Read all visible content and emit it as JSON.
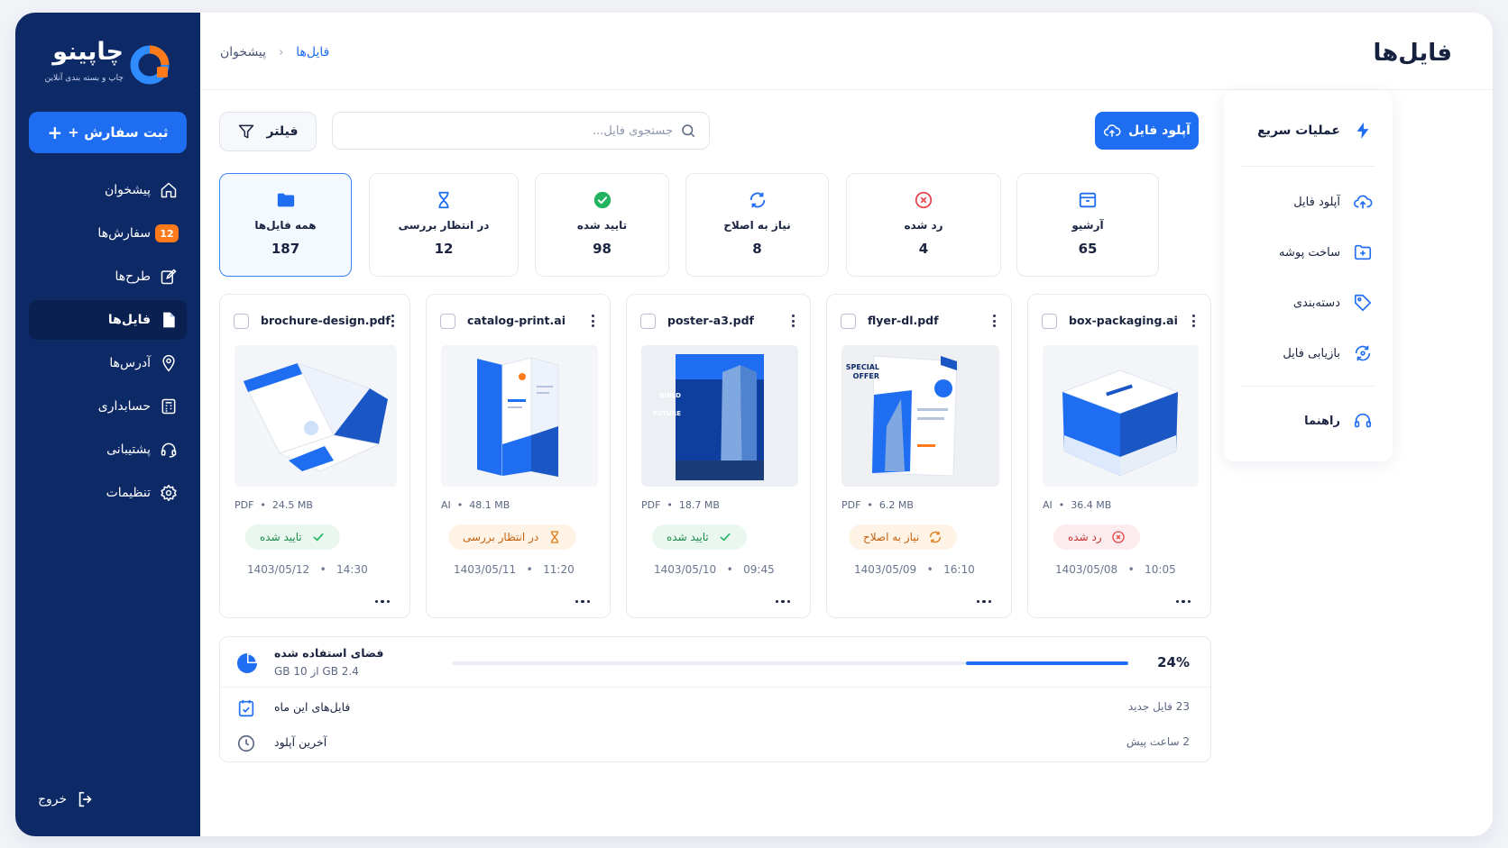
{
  "brand": {
    "name": "چاپینو",
    "tagline": "چاپ و بسته بندی آنلاین"
  },
  "sidebar": {
    "new_order_label": "ثبت سفارش +",
    "items": [
      {
        "label": "پیشخوان",
        "icon": "home-icon"
      },
      {
        "label": "سفارش‌ها",
        "icon": "orders-icon",
        "badge": "12"
      },
      {
        "label": "طرح‌ها",
        "icon": "design-icon"
      },
      {
        "label": "فایل‌ها",
        "icon": "file-icon",
        "active": true
      },
      {
        "label": "آدرس‌ها",
        "icon": "location-icon"
      },
      {
        "label": "حسابداری",
        "icon": "accounting-icon"
      },
      {
        "label": "پشتیبانی",
        "icon": "headset-icon"
      },
      {
        "label": "تنظیمات",
        "icon": "gear-icon"
      }
    ],
    "logout_label": "خروج"
  },
  "header": {
    "title": "فایل‌ها",
    "breadcrumb": [
      "پیشخوان",
      "فایل‌ها"
    ]
  },
  "toolbar": {
    "upload_label": "آپلود فایل",
    "search_placeholder": "جستجوی فایل...",
    "filter_label": "فیلتر"
  },
  "stats": [
    {
      "label": "همه فایل‌ها",
      "count": "187",
      "icon": "folder-icon",
      "color": "#1f6ef2"
    },
    {
      "label": "در انتظار بررسی",
      "count": "12",
      "icon": "hourglass-icon",
      "color": "#1f6ef2"
    },
    {
      "label": "تایید شده",
      "count": "98",
      "icon": "check-circle-icon",
      "color": "#22b35e"
    },
    {
      "label": "نیاز به اصلاح",
      "count": "8",
      "icon": "refresh-icon",
      "color": "#1f6ef2"
    },
    {
      "label": "رد شده",
      "count": "4",
      "icon": "x-circle-icon",
      "color": "#e5484d"
    },
    {
      "label": "آرشیو",
      "count": "65",
      "icon": "archive-icon",
      "color": "#1f6ef2"
    }
  ],
  "files": [
    {
      "name": "brochure-design.pdf",
      "type": "PDF",
      "size": "24.5 MB",
      "status": "تایید شده",
      "status_key": "approved",
      "date": "1403/05/12",
      "time": "14:30"
    },
    {
      "name": "catalog-print.ai",
      "type": "AI",
      "size": "48.1 MB",
      "status": "در انتظار بررسی",
      "status_key": "pending",
      "date": "1403/05/11",
      "time": "11:20"
    },
    {
      "name": "poster-a3.pdf",
      "type": "PDF",
      "size": "18.7 MB",
      "status": "تایید شده",
      "status_key": "approved",
      "date": "1403/05/10",
      "time": "09:45",
      "thumb_text": [
        "BUILD",
        "FUTURE"
      ]
    },
    {
      "name": "flyer-dl.pdf",
      "type": "PDF",
      "size": "6.2 MB",
      "status": "نیاز به اصلاح",
      "status_key": "needs-fix",
      "date": "1403/05/09",
      "time": "16:10",
      "thumb_text": [
        "SPECIAL",
        "OFFER"
      ]
    },
    {
      "name": "box-packaging.ai",
      "type": "AI",
      "size": "36.4 MB",
      "status": "رد شده",
      "status_key": "rejected",
      "date": "1403/05/08",
      "time": "10:05"
    }
  ],
  "storage": {
    "title": "فضای استفاده شده",
    "used_text": "2.4 GB از 10 GB",
    "percent_label": "24%",
    "percent": 24,
    "rows": [
      {
        "label": "فایل‌های این ماه",
        "value": "23 فایل جدید",
        "icon": "calendar-file-icon"
      },
      {
        "label": "آخرین آپلود",
        "value": "2 ساعت پیش",
        "icon": "clock-icon"
      }
    ]
  },
  "quick_actions": {
    "title": "عملیات سریع",
    "items": [
      {
        "label": "آپلود فایل",
        "icon": "cloud-upload-icon"
      },
      {
        "label": "ساخت پوشه",
        "icon": "folder-plus-icon"
      },
      {
        "label": "دسته‌بندی",
        "icon": "tag-icon"
      },
      {
        "label": "بازیابی فایل",
        "icon": "restore-icon"
      }
    ],
    "help_label": "راهنما"
  },
  "colors": {
    "sidebar_bg": "#0d2a66",
    "accent": "#1f6ef2",
    "approved": "#22b35e",
    "pending": "#e07a16",
    "rejected": "#e5484d"
  }
}
